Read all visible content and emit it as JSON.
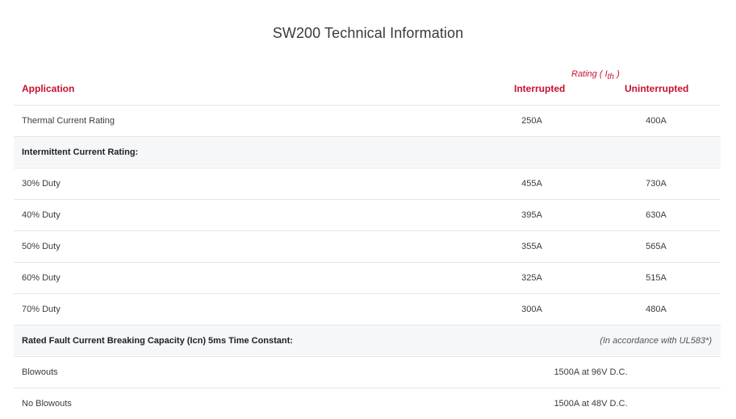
{
  "page": {
    "title": "SW200 Technical Information"
  },
  "table": {
    "rating_caption_main": "Rating (",
    "rating_caption_symbol": "I",
    "rating_caption_sub": "th",
    "rating_caption_end": ")",
    "headers": {
      "application": "Application",
      "interrupted": "Interrupted",
      "uninterrupted": "Uninterrupted"
    },
    "thermal": {
      "label": "Thermal Current Rating",
      "interrupted": "250A",
      "uninterrupted": "400A"
    },
    "intermittent_section": "Intermittent Current Rating:",
    "duty_rows": [
      {
        "label": "30% Duty",
        "interrupted": "455A",
        "uninterrupted": "730A"
      },
      {
        "label": "40% Duty",
        "interrupted": "395A",
        "uninterrupted": "630A"
      },
      {
        "label": "50% Duty",
        "interrupted": "355A",
        "uninterrupted": "565A"
      },
      {
        "label": "60% Duty",
        "interrupted": "325A",
        "uninterrupted": "515A"
      },
      {
        "label": "70% Duty",
        "interrupted": "300A",
        "uninterrupted": "480A"
      }
    ],
    "fault_section": "Rated Fault Current Breaking Capacity (Icn) 5ms Time Constant:",
    "fault_note": "(In accordance with UL583*)",
    "fault_rows": [
      {
        "label": "Blowouts",
        "value": "1500A at 96V D.C."
      },
      {
        "label": "No Blowouts",
        "value": "1500A at 48V D.C."
      }
    ]
  },
  "colors": {
    "accent_red": "#c8102e",
    "row_shade": "#f6f7f9",
    "divider": "#e6e6e6"
  }
}
